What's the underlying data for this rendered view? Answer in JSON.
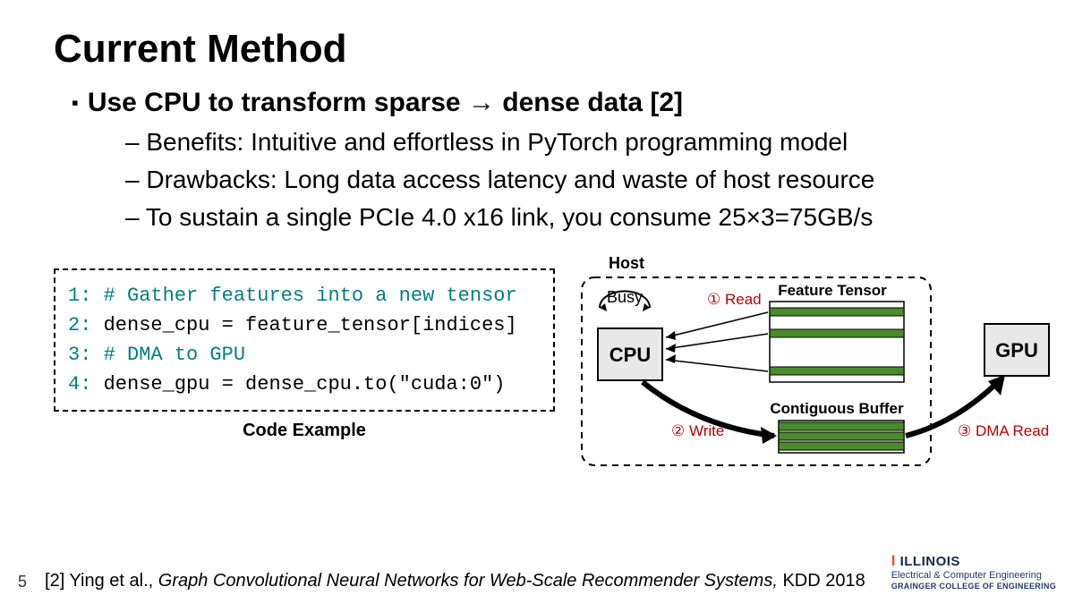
{
  "title": "Current Method",
  "main_bullet": "Use CPU to transform sparse → dense data [2]",
  "subs": {
    "a": "Benefits: Intuitive and effortless in PyTorch programming model",
    "b": "Drawbacks: Long data access latency and waste of host resource",
    "c": "To sustain a single PCIe 4.0 x16 link, you consume 25×3=75GB/s"
  },
  "code": {
    "l1": "# Gather features into a new tensor",
    "l2": "dense_cpu = feature_tensor[indices]",
    "l3": "# DMA to GPU",
    "l4": "dense_gpu = dense_cpu.to(\"cuda:0\")",
    "caption": "Code Example"
  },
  "diagram": {
    "host_label": "Host",
    "busy": "Busy",
    "cpu": "CPU",
    "gpu": "GPU",
    "feature_tensor": "Feature Tensor",
    "contig": "Contiguous Buffer",
    "step1": "① Read",
    "step2": "② Write",
    "step3": "③ DMA Read"
  },
  "footer": {
    "page": "5",
    "cite_prefix": "[2] Ying et al., ",
    "cite_title": "Graph Convolutional Neural Networks for Web-Scale Recommender Systems,",
    "cite_suffix": " KDD 2018",
    "logo_top": "ILLINOIS",
    "logo_mid": "Electrical & Computer Engineering",
    "logo_bot": "GRAINGER COLLEGE OF ENGINEERING"
  }
}
